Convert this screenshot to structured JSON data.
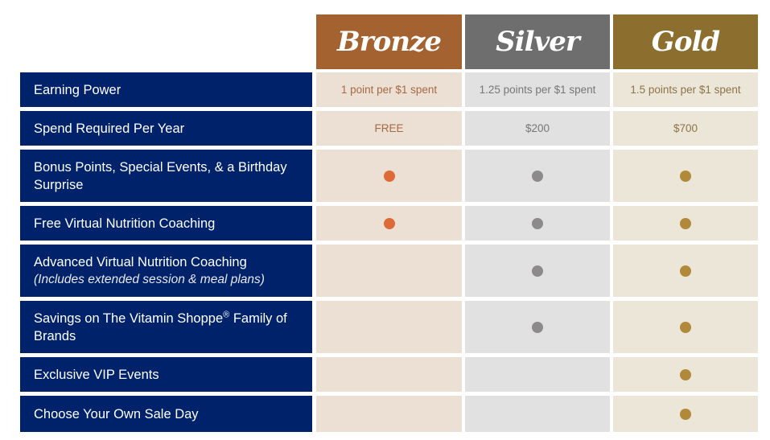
{
  "tiers": [
    {
      "name": "Bronze",
      "color": "#a3622f"
    },
    {
      "name": "Silver",
      "color": "#6e6e6e"
    },
    {
      "name": "Gold",
      "color": "#8c6e2f"
    }
  ],
  "rows": [
    {
      "label": "Earning Power",
      "bronze": "1 point per $1 spent",
      "silver": "1.25 points per $1 spent",
      "gold": "1.5 points per $1 spent"
    },
    {
      "label": "Spend Required Per Year",
      "bronze": "FREE",
      "silver": "$200",
      "gold": "$700"
    },
    {
      "label": "Bonus Points, Special Events, & a Birthday Surprise",
      "bronze": true,
      "silver": true,
      "gold": true
    },
    {
      "label": "Free Virtual Nutrition Coaching",
      "bronze": true,
      "silver": true,
      "gold": true
    },
    {
      "label": "Advanced Virtual Nutrition Coaching",
      "sublabel": "(Includes extended session & meal plans)",
      "bronze": false,
      "silver": true,
      "gold": true
    },
    {
      "label": "Savings on The Vitamin Shoppe",
      "label_sup": "®",
      "label_after": " Family of Brands",
      "bronze": false,
      "silver": true,
      "gold": true
    },
    {
      "label": "Exclusive VIP Events",
      "bronze": false,
      "silver": false,
      "gold": true
    },
    {
      "label": "Choose Your Own Sale Day",
      "bronze": false,
      "silver": false,
      "gold": true
    }
  ],
  "icons": {
    "included": "filled-dot-icon"
  }
}
